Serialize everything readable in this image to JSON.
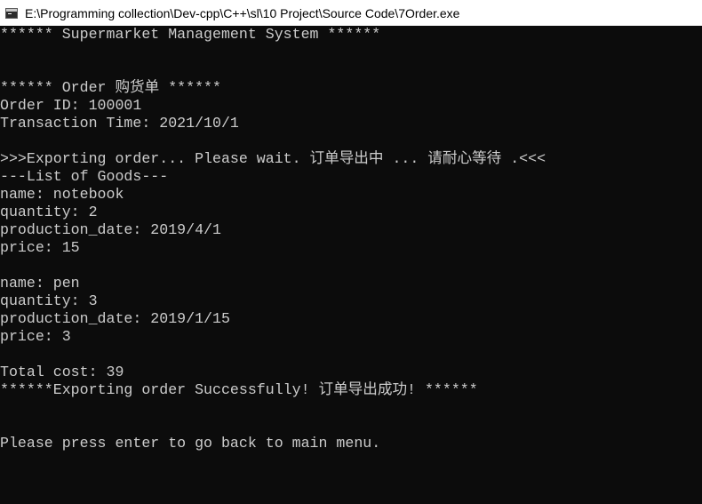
{
  "window": {
    "title": "E:\\Programming collection\\Dev-cpp\\C++\\sl\\10 Project\\Source Code\\7Order.exe"
  },
  "console": {
    "lines": [
      "****** Supermarket Management System ******",
      "",
      "",
      "****** Order 购货单 ******",
      "Order ID: 100001",
      "Transaction Time: 2021/10/1",
      "",
      ">>>Exporting order... Please wait. 订单导出中 ... 请耐心等待 .<<<",
      "---List of Goods---",
      "name: notebook",
      "quantity: 2",
      "production_date: 2019/4/1",
      "price: 15",
      "",
      "name: pen",
      "quantity: 3",
      "production_date: 2019/1/15",
      "price: 3",
      "",
      "Total cost: 39",
      "******Exporting order Successfully! 订单导出成功! ******",
      "",
      "",
      "Please press enter to go back to main menu."
    ]
  }
}
